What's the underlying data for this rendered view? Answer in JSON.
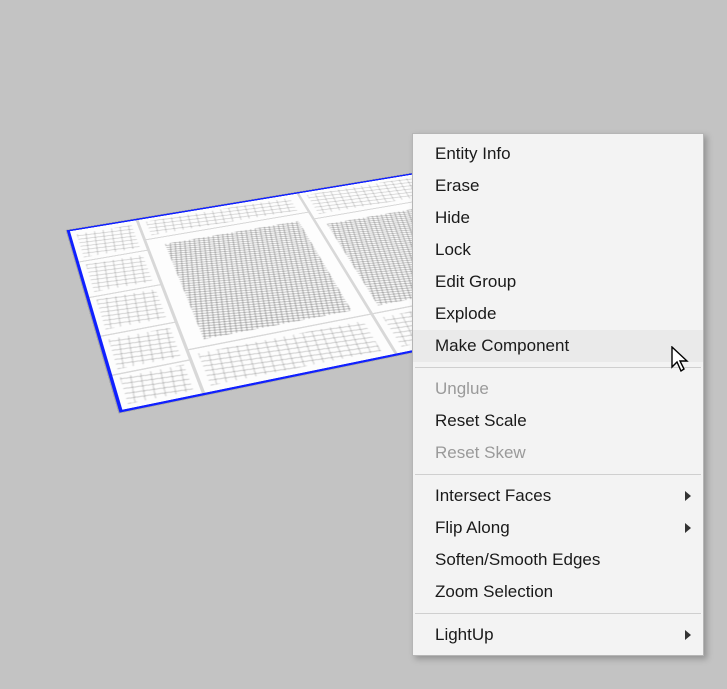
{
  "canvas": {
    "selection": "imported-drawing-group"
  },
  "context_menu": {
    "groups": [
      {
        "items": [
          {
            "id": "entity-info",
            "label": "Entity Info",
            "enabled": true,
            "submenu": false,
            "hovered": false
          },
          {
            "id": "erase",
            "label": "Erase",
            "enabled": true,
            "submenu": false,
            "hovered": false
          },
          {
            "id": "hide",
            "label": "Hide",
            "enabled": true,
            "submenu": false,
            "hovered": false
          },
          {
            "id": "lock",
            "label": "Lock",
            "enabled": true,
            "submenu": false,
            "hovered": false
          },
          {
            "id": "edit-group",
            "label": "Edit Group",
            "enabled": true,
            "submenu": false,
            "hovered": false
          },
          {
            "id": "explode",
            "label": "Explode",
            "enabled": true,
            "submenu": false,
            "hovered": false
          },
          {
            "id": "make-component",
            "label": "Make Component",
            "enabled": true,
            "submenu": false,
            "hovered": true
          }
        ]
      },
      {
        "items": [
          {
            "id": "unglue",
            "label": "Unglue",
            "enabled": false,
            "submenu": false,
            "hovered": false
          },
          {
            "id": "reset-scale",
            "label": "Reset Scale",
            "enabled": true,
            "submenu": false,
            "hovered": false
          },
          {
            "id": "reset-skew",
            "label": "Reset Skew",
            "enabled": false,
            "submenu": false,
            "hovered": false
          }
        ]
      },
      {
        "items": [
          {
            "id": "intersect-faces",
            "label": "Intersect Faces",
            "enabled": true,
            "submenu": true,
            "hovered": false
          },
          {
            "id": "flip-along",
            "label": "Flip Along",
            "enabled": true,
            "submenu": true,
            "hovered": false
          },
          {
            "id": "soften-smooth-edges",
            "label": "Soften/Smooth Edges",
            "enabled": true,
            "submenu": false,
            "hovered": false
          },
          {
            "id": "zoom-selection",
            "label": "Zoom Selection",
            "enabled": true,
            "submenu": false,
            "hovered": false
          }
        ]
      },
      {
        "items": [
          {
            "id": "lightup",
            "label": "LightUp",
            "enabled": true,
            "submenu": true,
            "hovered": false
          }
        ]
      }
    ]
  }
}
